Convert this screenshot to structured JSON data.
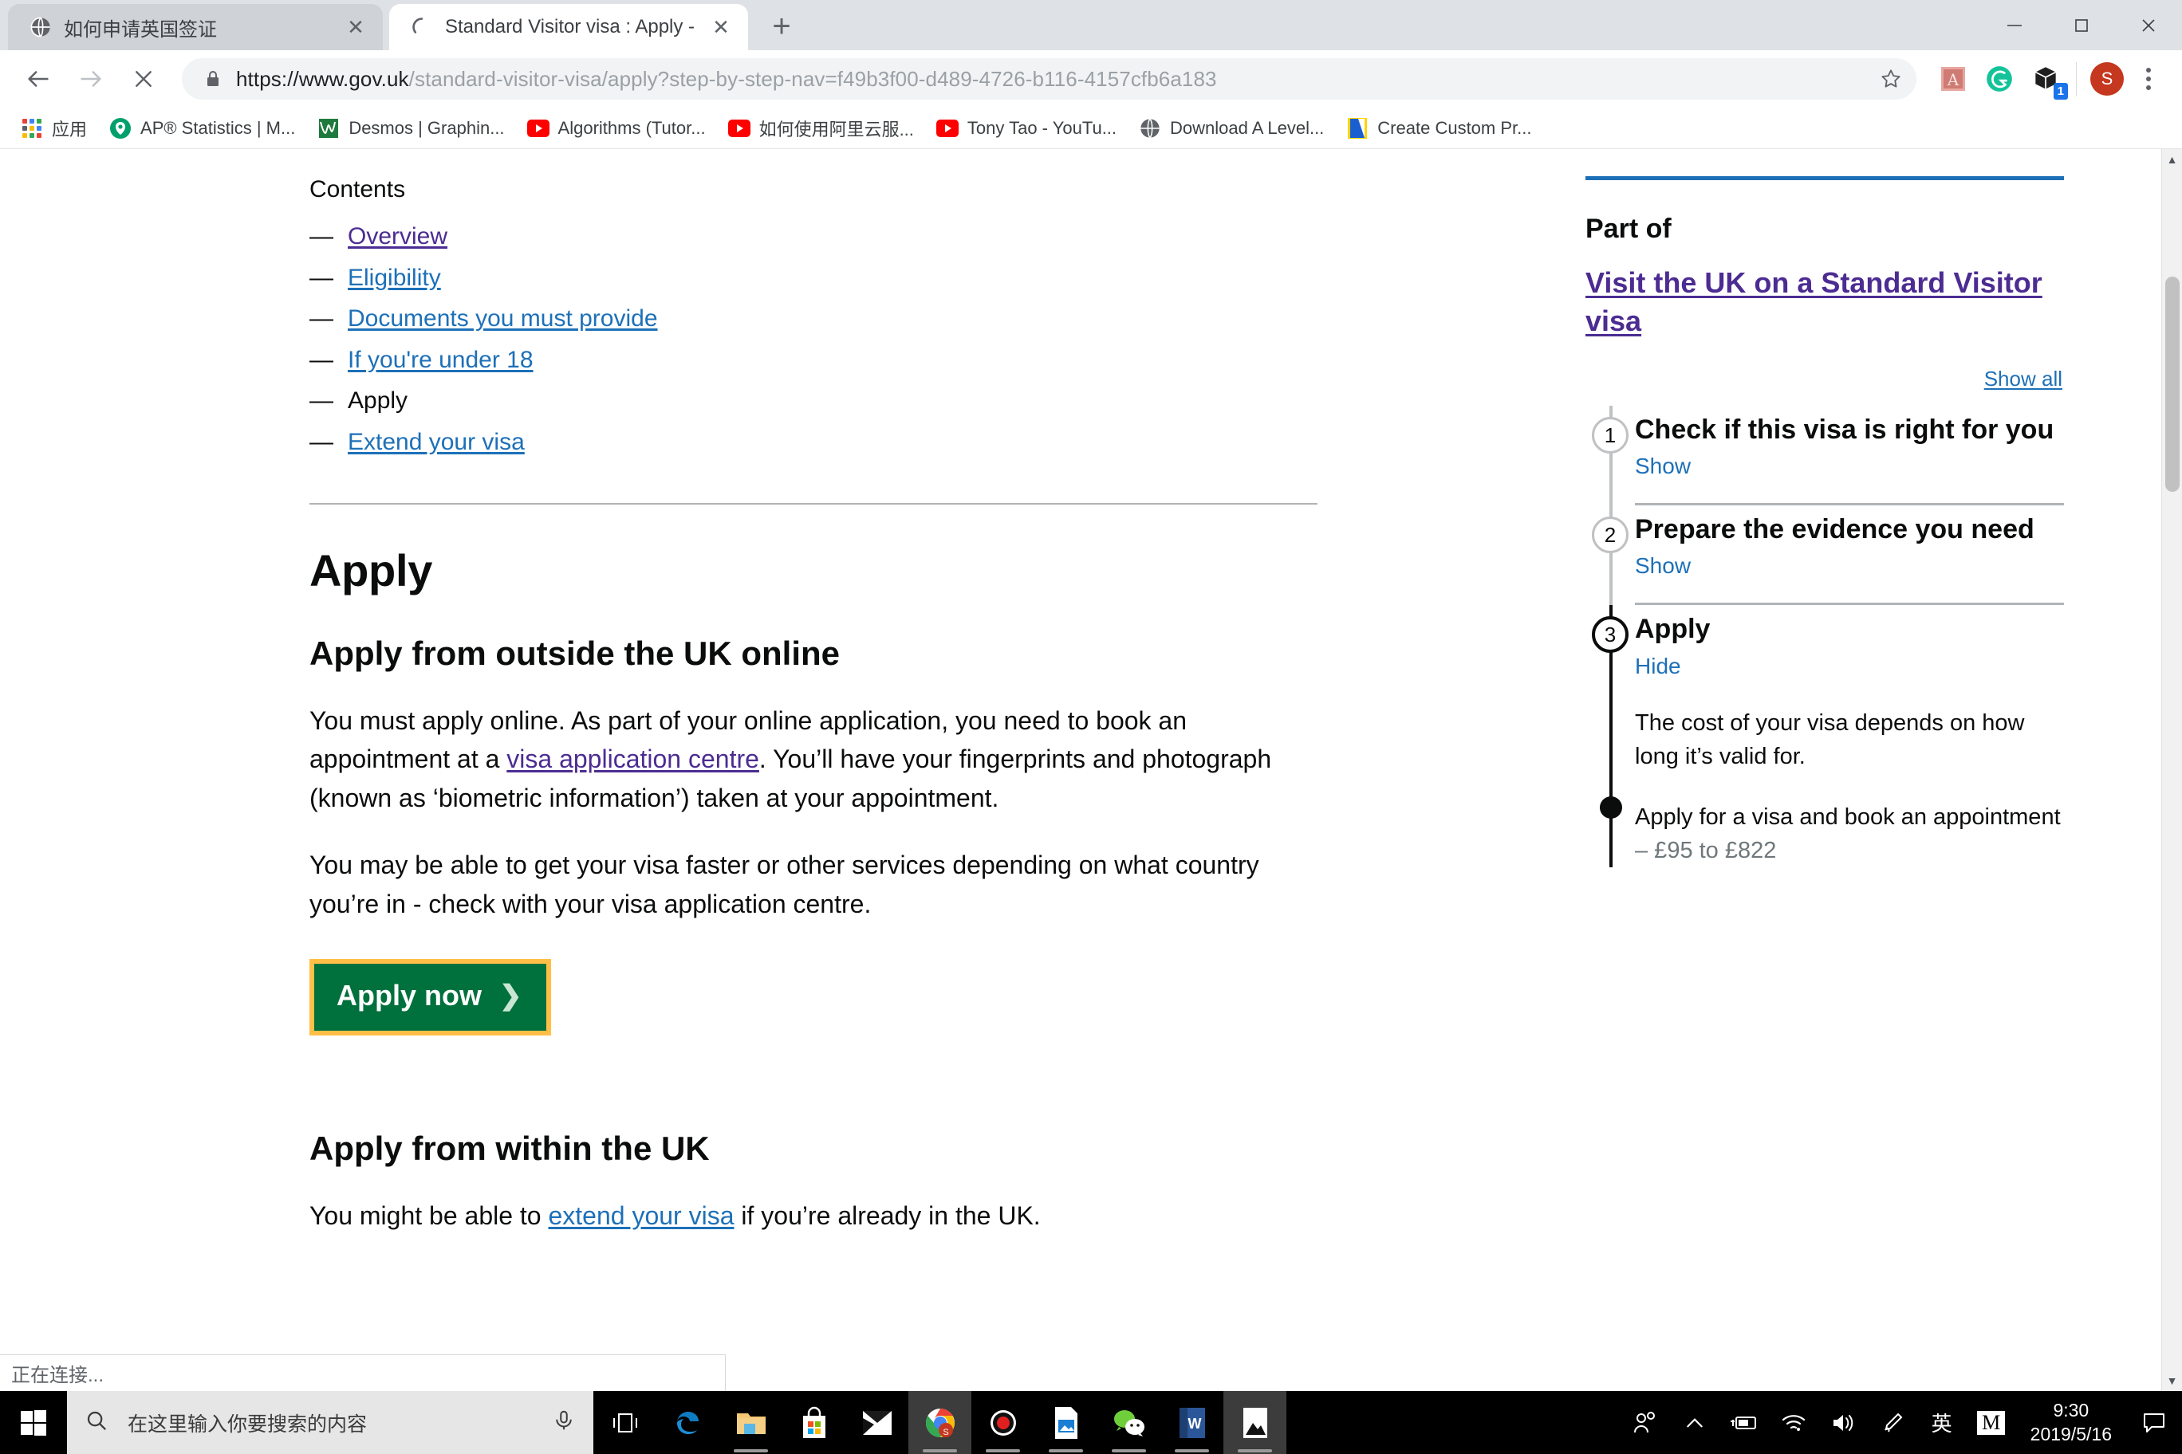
{
  "browser": {
    "tabs": [
      {
        "title": "如何申请英国签证",
        "favicon": "globe-icon",
        "active": false
      },
      {
        "title": "Standard Visitor visa : Apply - ",
        "favicon": "loading-spinner-icon",
        "active": true
      }
    ],
    "new_tab_label": "+",
    "window_controls": {
      "minimize": "─",
      "maximize": "❐",
      "close": "✕"
    },
    "nav": {
      "back": "back-arrow-icon",
      "forward": "forward-arrow-icon",
      "stop": "stop-loading-icon"
    },
    "omnibox": {
      "lock": "lock-icon",
      "url_bold": "https://www.gov.uk",
      "url_rest": "/standard-visitor-visa/apply?step-by-step-nav=f49b3f00-d489-4726-b116-4157cfb6a183",
      "bookmark_star": "star-icon"
    },
    "extensions": [
      {
        "name": "adobe-acrobat-extension-icon",
        "badge": ""
      },
      {
        "name": "grammarly-extension-icon",
        "badge": ""
      },
      {
        "name": "package-extension-icon",
        "badge": "1"
      }
    ],
    "profile_initial": "S",
    "menu": "chrome-menu-icon",
    "bookmarks": [
      {
        "label": "应用",
        "icon": "apps-grid-icon"
      },
      {
        "label": "AP® Statistics | M...",
        "icon": "collegeboard-icon"
      },
      {
        "label": "Desmos | Graphin...",
        "icon": "desmos-icon"
      },
      {
        "label": "Algorithms (Tutor...",
        "icon": "youtube-icon"
      },
      {
        "label": "如何使用阿里云服...",
        "icon": "youtube-icon"
      },
      {
        "label": "Tony Tao - YouTu...",
        "icon": "youtube-icon"
      },
      {
        "label": "Download A Level...",
        "icon": "globe-icon"
      },
      {
        "label": "Create Custom Pr...",
        "icon": "blue-page-icon"
      }
    ],
    "status_text": "正在连接..."
  },
  "page": {
    "contents_label": "Contents",
    "contents": [
      {
        "label": "Overview",
        "state": "visited"
      },
      {
        "label": "Eligibility",
        "state": "link"
      },
      {
        "label": "Documents you must provide",
        "state": "link"
      },
      {
        "label": "If you're under 18",
        "state": "link"
      },
      {
        "label": "Apply",
        "state": "current"
      },
      {
        "label": "Extend your visa",
        "state": "link"
      }
    ],
    "dash": "—",
    "h1": "Apply",
    "section1": {
      "heading": "Apply from outside the UK online",
      "para1_a": "You must apply online. As part of your online application, you need to book an appointment at a ",
      "para1_link": "visa application centre",
      "para1_b": ". You’ll have your fingerprints and photograph (known as ‘biometric information’) taken at your appointment.",
      "para2": "You may be able to get your visa faster or other services depending on what country you’re in - check with your visa application centre.",
      "button_label": "Apply now",
      "button_chevron": "❯"
    },
    "section2": {
      "heading": "Apply from within the UK",
      "para_a": "You might be able to ",
      "para_link": "extend your visa",
      "para_b": " if you’re already in the UK."
    },
    "sidebar": {
      "part_of_label": "Part of",
      "part_of_title": "Visit the UK on a Standard Visitor visa",
      "show_all": "Show all",
      "steps": [
        {
          "number": "1",
          "title": "Check if this visa is right for you",
          "toggle": "Show",
          "expanded": false
        },
        {
          "number": "2",
          "title": "Prepare the evidence you need",
          "toggle": "Show",
          "expanded": false
        },
        {
          "number": "3",
          "title": "Apply",
          "toggle": "Hide",
          "expanded": true,
          "paragraphs": [
            {
              "text": "The cost of your visa depends on how long it’s valid for.",
              "muted_suffix": ""
            },
            {
              "text": "Apply for a visa and book an appointment",
              "muted_suffix": " – £95 to £822"
            }
          ]
        }
      ]
    }
  },
  "taskbar": {
    "start": "windows-start-icon",
    "search_icon": "search-icon",
    "search_placeholder": "在这里输入你要搜索的内容",
    "mic_icon": "microphone-icon",
    "taskview_icon": "task-view-icon",
    "apps": [
      {
        "name": "microsoft-edge-icon",
        "running": false,
        "focused": false
      },
      {
        "name": "file-explorer-icon",
        "running": true,
        "focused": false
      },
      {
        "name": "microsoft-store-icon",
        "running": false,
        "focused": false
      },
      {
        "name": "mail-icon",
        "running": false,
        "focused": false
      },
      {
        "name": "google-chrome-icon",
        "running": true,
        "focused": true
      },
      {
        "name": "recorder-icon",
        "running": true,
        "focused": false
      },
      {
        "name": "photo-viewer-icon",
        "running": true,
        "focused": false
      },
      {
        "name": "wechat-icon",
        "running": true,
        "focused": false
      },
      {
        "name": "microsoft-word-icon",
        "running": true,
        "focused": false
      },
      {
        "name": "photos-app-icon",
        "running": true,
        "focused": true
      }
    ],
    "tray": [
      {
        "name": "people-icon"
      },
      {
        "name": "show-hidden-icons-chevron-icon"
      },
      {
        "name": "battery-charging-icon"
      },
      {
        "name": "wifi-icon"
      },
      {
        "name": "volume-icon"
      },
      {
        "name": "pen-workspace-icon"
      },
      {
        "name": "ime-language-icon",
        "text": "英"
      },
      {
        "name": "ime-mode-icon",
        "text": "M"
      }
    ],
    "clock_time": "9:30",
    "clock_date": "2019/5/16",
    "notifications": "action-center-icon"
  },
  "colors": {
    "govuk_green": "#00703c",
    "govuk_focus_yellow": "#ffbf47",
    "govuk_link_blue": "#1d70b8",
    "govuk_visited_purple": "#4c2c92",
    "govuk_text": "#0b0c0c",
    "chrome_tabstrip": "#dee1e6",
    "taskbar_black": "#000000"
  }
}
